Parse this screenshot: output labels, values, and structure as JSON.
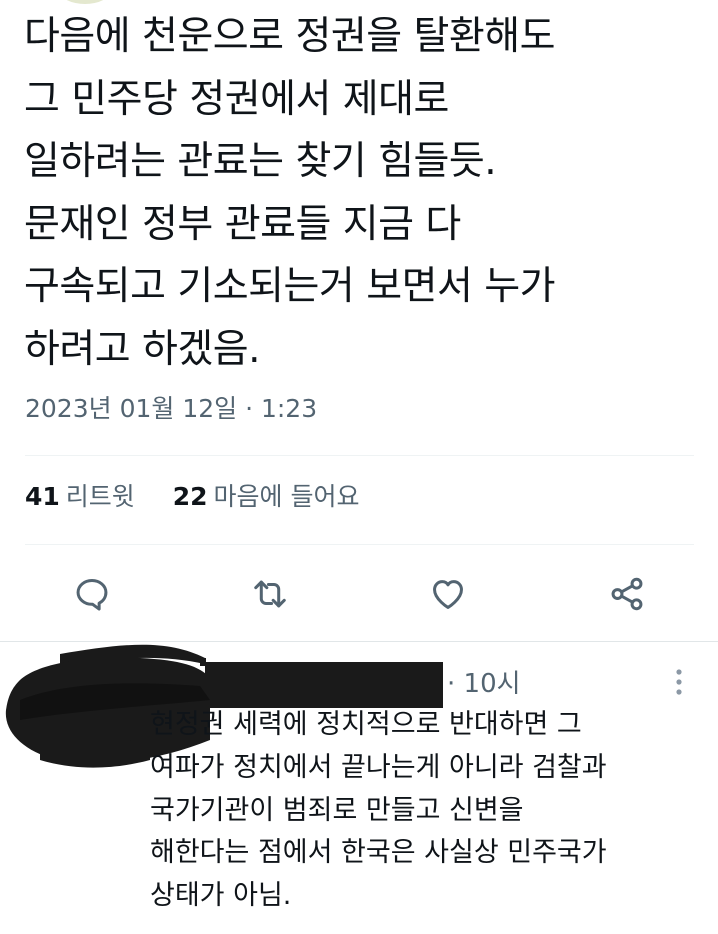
{
  "tweet": {
    "lines": [
      "다음에 천운으로 정권을 탈환해도",
      "그 민주당 정권에서 제대로",
      "일하려는 관료는 찾기 힘들듯.",
      "문재인 정부 관료들 지금 다",
      "구속되고 기소되는거 보면서 누가",
      "하려고 하겠음."
    ],
    "timestamp": "2023년 01월 12일 · 1:23"
  },
  "stats": {
    "retweets_count": "41",
    "retweets_label": "리트윗",
    "likes_count": "22",
    "likes_label": "마음에 들어요"
  },
  "actions": {
    "icons": [
      "reply-icon",
      "retweet-icon",
      "like-icon",
      "share-icon"
    ],
    "icon_color": "#536471"
  },
  "reply": {
    "time": "· 10시",
    "lines": [
      "현정권 세력에 정치적으로 반대하면 그",
      "여파가 정치에서 끝나는게 아니라 검찰과",
      "국가기관이 범죄로 만들고 신변을",
      "해한다는 점에서 한국은 사실상 민주국가",
      "상태가 아님."
    ]
  },
  "colors": {
    "text": "#0f1419",
    "secondary": "#536471",
    "divider": "#eff3f4",
    "redaction": "#1a1a1a"
  }
}
